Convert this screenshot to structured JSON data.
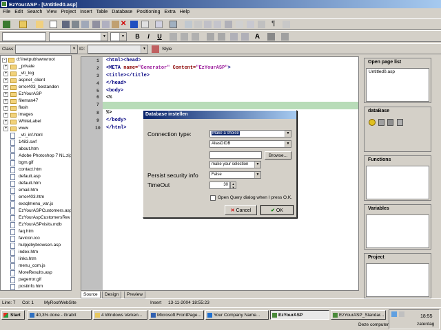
{
  "window": {
    "title": "EzYourASP - [Untitled0.asp]"
  },
  "menu": [
    "File",
    "Edit",
    "Search",
    "View",
    "Project",
    "Insert",
    "Table",
    "Database",
    "Positioning",
    "Extra",
    "Help"
  ],
  "toolbar3": {
    "class_label": "Class:",
    "id_label": "ID:",
    "style_label": "Style"
  },
  "tree": {
    "root": "d:\\inetpub\\wwwroot",
    "folders": [
      "_private",
      "_vti_log",
      "aspnet_client",
      "error403_bestanden",
      "EzYourASP",
      "fileman47",
      "flash",
      "images",
      "WhiteLabel",
      "www"
    ],
    "files": [
      "_vti_inf.html",
      "1483.swf",
      "about.htm",
      "Adobe Photoshop 7 NL.zip",
      "bgm.gif",
      "contact.htm",
      "default.asp",
      "default.htm",
      "email.htm",
      "error403.htm",
      "exsqlmenu_var.js",
      "EzYourASPCustomers.asp",
      "EzYourAspCustomersRev",
      "EzYourASPvisits.mdb",
      "faq.htm",
      "favicon.ico",
      "hulpjebybrowsen.asp",
      "index.htm",
      "links.htm",
      "menu_com.js",
      "MoreResults.asp",
      "pagerror.gif",
      "postinfo.htm"
    ]
  },
  "editor": {
    "line_numbers": [
      "1",
      "2",
      "3",
      "4",
      "5",
      "6",
      "7",
      "8",
      "9",
      "10"
    ],
    "lines": {
      "l1": "<html><head>",
      "l2_tag": "<META ",
      "l2_a1": "name=",
      "l2_v1": "\"Generator\"",
      "l2_a2": " Content=",
      "l2_v2": "\"EzYourASP\"",
      "l2_end": ">",
      "l3": "<title></title>",
      "l4": "</head>",
      "l5": "<body>",
      "l6": "<%",
      "l8": "%>",
      "l9": "</body>",
      "l10": "</html>"
    },
    "tabs": [
      "Source",
      "Design",
      "Preview"
    ]
  },
  "panels": {
    "open_pages": {
      "title": "Open page list",
      "items": [
        "Untitled0.asp"
      ]
    },
    "database": {
      "title": "dataBase"
    },
    "functions": {
      "title": "Functions"
    },
    "variables": {
      "title": "Variables"
    },
    "project": {
      "title": "Project"
    }
  },
  "dialog": {
    "title": "Database instellen",
    "connection_type_label": "Connection type:",
    "connection_type_value": "Make a choice",
    "provider_value": "AliasDIDB",
    "path_value": "",
    "browse_label": "Browse...",
    "auth_value": "make your selection",
    "persist_label": "Persist security info",
    "persist_value": "False",
    "timeout_label": "TimeOut",
    "timeout_value": "30",
    "open_query_label": "Open Query dialog when I press O.K.",
    "cancel_label": "Cancel",
    "ok_label": "OK"
  },
  "status": {
    "line": "Line: 7",
    "col": "Col: 1",
    "site": "MyRootWebSite",
    "mode": "Insert",
    "datetime": "13-11-2004 18:55:23"
  },
  "taskbar": {
    "start": "Start",
    "tasks": [
      "40,3% done - GrabIt",
      "4 Windows Verken...",
      "Microsoft FrontPage...",
      "Your Company Name...",
      "EzYourASP",
      "EzYourASP_Standar..."
    ],
    "deze_computer": "Deze computer",
    "clock": "18:55",
    "day": "zaterdag"
  },
  "colors": {
    "titlebar": "#0a246a",
    "highlight_line": "#b8dcb8",
    "gutter": "#c0c0c0"
  }
}
